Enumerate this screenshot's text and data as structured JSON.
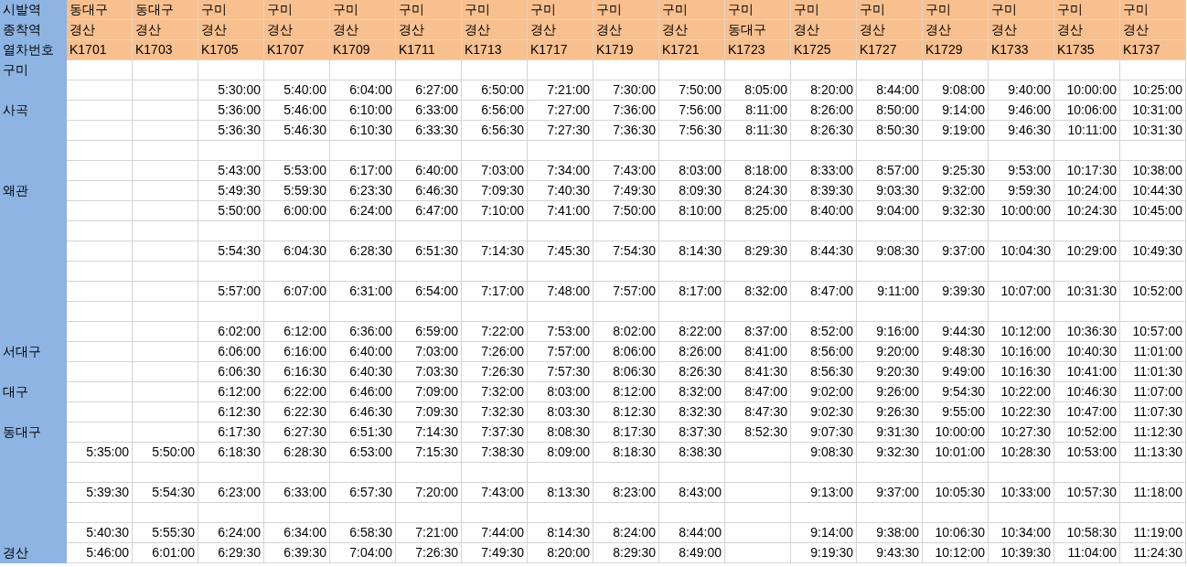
{
  "header_rows": [
    {
      "label": "시발역",
      "cells": [
        "동대구",
        "동대구",
        "구미",
        "구미",
        "구미",
        "구미",
        "구미",
        "구미",
        "구미",
        "구미",
        "구미",
        "구미",
        "구미",
        "구미",
        "구미",
        "구미",
        "구미"
      ]
    },
    {
      "label": "종착역",
      "cells": [
        "경산",
        "경산",
        "경산",
        "경산",
        "경산",
        "경산",
        "경산",
        "경산",
        "경산",
        "경산",
        "동대구",
        "경산",
        "경산",
        "경산",
        "경산",
        "경산",
        "경산"
      ]
    },
    {
      "label": "열차번호",
      "cells": [
        "K1701",
        "K1703",
        "K1705",
        "K1707",
        "K1709",
        "K1711",
        "K1713",
        "K1717",
        "K1719",
        "K1721",
        "K1723",
        "K1725",
        "K1727",
        "K1729",
        "K1733",
        "K1735",
        "K1737"
      ]
    }
  ],
  "rows": [
    {
      "station": "구미",
      "cells": [
        null,
        null,
        null,
        null,
        null,
        null,
        null,
        null,
        null,
        null,
        null,
        null,
        null,
        null,
        null,
        null,
        null
      ]
    },
    {
      "cells": [
        null,
        null,
        "5:30:00",
        "5:40:00",
        "6:04:00",
        "6:27:00",
        "6:50:00",
        "7:21:00",
        "7:30:00",
        "7:50:00",
        "8:05:00",
        "8:20:00",
        "8:44:00",
        "9:08:00",
        "9:40:00",
        "10:00:00",
        "10:25:00"
      ]
    },
    {
      "station": "사곡",
      "cells": [
        null,
        null,
        "5:36:00",
        "5:46:00",
        "6:10:00",
        "6:33:00",
        "6:56:00",
        "7:27:00",
        "7:36:00",
        "7:56:00",
        "8:11:00",
        "8:26:00",
        "8:50:00",
        "9:14:00",
        "9:46:00",
        "10:06:00",
        "10:31:00"
      ]
    },
    {
      "cells": [
        null,
        null,
        "5:36:30",
        "5:46:30",
        "6:10:30",
        "6:33:30",
        "6:56:30",
        "7:27:30",
        "7:36:30",
        "7:56:30",
        "8:11:30",
        "8:26:30",
        "8:50:30",
        "9:19:00",
        "9:46:30",
        "10:11:00",
        "10:31:30"
      ]
    },
    {
      "cells": [
        null,
        null,
        null,
        null,
        null,
        null,
        null,
        null,
        null,
        null,
        null,
        null,
        null,
        null,
        null,
        null,
        null
      ]
    },
    {
      "cells": [
        null,
        null,
        "5:43:00",
        "5:53:00",
        "6:17:00",
        "6:40:00",
        "7:03:00",
        "7:34:00",
        "7:43:00",
        "8:03:00",
        "8:18:00",
        "8:33:00",
        "8:57:00",
        "9:25:30",
        "9:53:00",
        "10:17:30",
        "10:38:00"
      ]
    },
    {
      "station": "왜관",
      "cells": [
        null,
        null,
        "5:49:30",
        "5:59:30",
        "6:23:30",
        "6:46:30",
        "7:09:30",
        "7:40:30",
        "7:49:30",
        "8:09:30",
        "8:24:30",
        "8:39:30",
        "9:03:30",
        "9:32:00",
        "9:59:30",
        "10:24:00",
        "10:44:30"
      ]
    },
    {
      "cells": [
        null,
        null,
        "5:50:00",
        "6:00:00",
        "6:24:00",
        "6:47:00",
        "7:10:00",
        "7:41:00",
        "7:50:00",
        "8:10:00",
        "8:25:00",
        "8:40:00",
        "9:04:00",
        "9:32:30",
        "10:00:00",
        "10:24:30",
        "10:45:00"
      ]
    },
    {
      "cells": [
        null,
        null,
        null,
        null,
        null,
        null,
        null,
        null,
        null,
        null,
        null,
        null,
        null,
        null,
        null,
        null,
        null
      ]
    },
    {
      "cells": [
        null,
        null,
        "5:54:30",
        "6:04:30",
        "6:28:30",
        "6:51:30",
        "7:14:30",
        "7:45:30",
        "7:54:30",
        "8:14:30",
        "8:29:30",
        "8:44:30",
        "9:08:30",
        "9:37:00",
        "10:04:30",
        "10:29:00",
        "10:49:30"
      ]
    },
    {
      "cells": [
        null,
        null,
        null,
        null,
        null,
        null,
        null,
        null,
        null,
        null,
        null,
        null,
        null,
        null,
        null,
        null,
        null
      ]
    },
    {
      "cells": [
        null,
        null,
        "5:57:00",
        "6:07:00",
        "6:31:00",
        "6:54:00",
        "7:17:00",
        "7:48:00",
        "7:57:00",
        "8:17:00",
        "8:32:00",
        "8:47:00",
        "9:11:00",
        "9:39:30",
        "10:07:00",
        "10:31:30",
        "10:52:00"
      ]
    },
    {
      "cells": [
        null,
        null,
        null,
        null,
        null,
        null,
        null,
        null,
        null,
        null,
        null,
        null,
        null,
        null,
        null,
        null,
        null
      ]
    },
    {
      "cells": [
        null,
        null,
        "6:02:00",
        "6:12:00",
        "6:36:00",
        "6:59:00",
        "7:22:00",
        "7:53:00",
        "8:02:00",
        "8:22:00",
        "8:37:00",
        "8:52:00",
        "9:16:00",
        "9:44:30",
        "10:12:00",
        "10:36:30",
        "10:57:00"
      ]
    },
    {
      "station": "서대구",
      "cells": [
        null,
        null,
        "6:06:00",
        "6:16:00",
        "6:40:00",
        "7:03:00",
        "7:26:00",
        "7:57:00",
        "8:06:00",
        "8:26:00",
        "8:41:00",
        "8:56:00",
        "9:20:00",
        "9:48:30",
        "10:16:00",
        "10:40:30",
        "11:01:00"
      ]
    },
    {
      "cells": [
        null,
        null,
        "6:06:30",
        "6:16:30",
        "6:40:30",
        "7:03:30",
        "7:26:30",
        "7:57:30",
        "8:06:30",
        "8:26:30",
        "8:41:30",
        "8:56:30",
        "9:20:30",
        "9:49:00",
        "10:16:30",
        "10:41:00",
        "11:01:30"
      ]
    },
    {
      "station": "대구",
      "cells": [
        null,
        null,
        "6:12:00",
        "6:22:00",
        "6:46:00",
        "7:09:00",
        "7:32:00",
        "8:03:00",
        "8:12:00",
        "8:32:00",
        "8:47:00",
        "9:02:00",
        "9:26:00",
        "9:54:30",
        "10:22:00",
        "10:46:30",
        "11:07:00"
      ]
    },
    {
      "cells": [
        null,
        null,
        "6:12:30",
        "6:22:30",
        "6:46:30",
        "7:09:30",
        "7:32:30",
        "8:03:30",
        "8:12:30",
        "8:32:30",
        "8:47:30",
        "9:02:30",
        "9:26:30",
        "9:55:00",
        "10:22:30",
        "10:47:00",
        "11:07:30"
      ]
    },
    {
      "station": "동대구",
      "cells": [
        null,
        null,
        "6:17:30",
        "6:27:30",
        "6:51:30",
        "7:14:30",
        "7:37:30",
        "8:08:30",
        "8:17:30",
        "8:37:30",
        "8:52:30",
        "9:07:30",
        "9:31:30",
        "10:00:00",
        "10:27:30",
        "10:52:00",
        "11:12:30"
      ]
    },
    {
      "cells": [
        "5:35:00",
        "5:50:00",
        "6:18:30",
        "6:28:30",
        "6:53:00",
        "7:15:30",
        "7:38:30",
        "8:09:00",
        "8:18:30",
        "8:38:30",
        null,
        "9:08:30",
        "9:32:30",
        "10:01:00",
        "10:28:30",
        "10:53:00",
        "11:13:30"
      ]
    },
    {
      "cells": [
        null,
        null,
        null,
        null,
        null,
        null,
        null,
        null,
        null,
        null,
        null,
        null,
        null,
        null,
        null,
        null,
        null
      ]
    },
    {
      "cells": [
        "5:39:30",
        "5:54:30",
        "6:23:00",
        "6:33:00",
        "6:57:30",
        "7:20:00",
        "7:43:00",
        "8:13:30",
        "8:23:00",
        "8:43:00",
        null,
        "9:13:00",
        "9:37:00",
        "10:05:30",
        "10:33:00",
        "10:57:30",
        "11:18:00"
      ]
    },
    {
      "cells": [
        null,
        null,
        null,
        null,
        null,
        null,
        null,
        null,
        null,
        null,
        null,
        null,
        null,
        null,
        null,
        null,
        null
      ]
    },
    {
      "cells": [
        "5:40:30",
        "5:55:30",
        "6:24:00",
        "6:34:00",
        "6:58:30",
        "7:21:00",
        "7:44:00",
        "8:14:30",
        "8:24:00",
        "8:44:00",
        null,
        "9:14:00",
        "9:38:00",
        "10:06:30",
        "10:34:00",
        "10:58:30",
        "11:19:00"
      ]
    },
    {
      "station": "경산",
      "cells": [
        "5:46:00",
        "6:01:00",
        "6:29:30",
        "6:39:30",
        "7:04:00",
        "7:26:30",
        "7:49:30",
        "8:20:00",
        "8:29:30",
        "8:49:00",
        null,
        "9:19:30",
        "9:43:30",
        "10:12:00",
        "10:39:30",
        "11:04:00",
        "11:24:30"
      ]
    }
  ]
}
